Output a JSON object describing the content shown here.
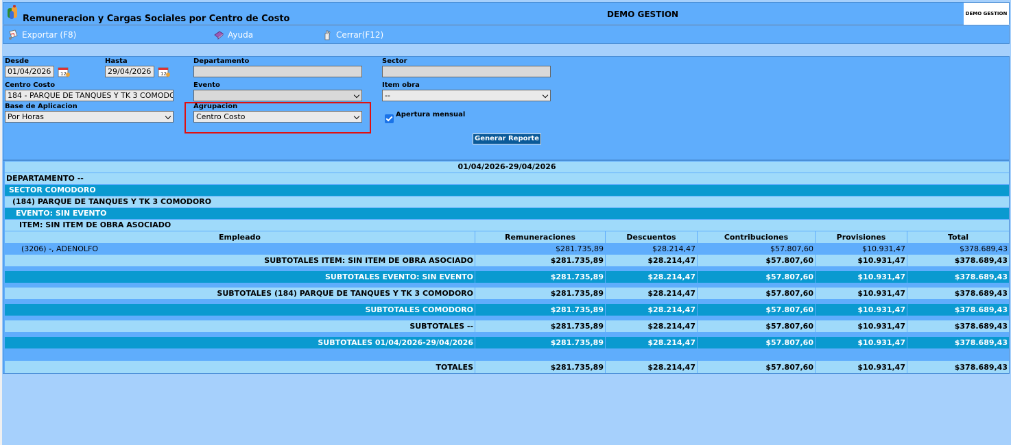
{
  "app": {
    "title": "Remuneracion y Cargas Sociales por Centro de Costo",
    "company": "DEMO GESTION",
    "logo_text": "DEMO GESTION"
  },
  "toolbar": {
    "export_label": "Exportar (F8)",
    "help_label": "Ayuda",
    "close_label": "Cerrar(F12)"
  },
  "filters": {
    "desde_label": "Desde",
    "desde_value": "01/04/2026",
    "hasta_label": "Hasta",
    "hasta_value": "29/04/2026",
    "departamento_label": "Departamento",
    "departamento_value": "",
    "sector_label": "Sector",
    "sector_value": "",
    "centro_costo_label": "Centro Costo",
    "centro_costo_value": "184 - PARQUE DE TANQUES Y TK 3 COMODORO",
    "evento_label": "Evento",
    "evento_value": "",
    "item_obra_label": "Item obra",
    "item_obra_value": "--",
    "base_label": "Base de Aplicacion",
    "base_value": "Por Horas",
    "agrupacion_label": "Agrupacion",
    "agrupacion_value": "Centro Costo",
    "apertura_label": "Apertura mensual",
    "apertura_checked": true,
    "generate_label": "Generar Reporte"
  },
  "report": {
    "period": "01/04/2026-29/04/2026",
    "departamento": "DEPARTAMENTO --",
    "sector": "SECTOR COMODORO",
    "centro": "(184) PARQUE DE TANQUES Y TK 3 COMODORO",
    "evento": "EVENTO: SIN EVENTO",
    "item": "ITEM: SIN ITEM DE OBRA ASOCIADO",
    "columns": [
      "Empleado",
      "Remuneraciones",
      "Descuentos",
      "Contribuciones",
      "Provisiones",
      "Total"
    ],
    "employee": {
      "name": "(3206) -, ADENOLFO",
      "values": [
        "$281.735,89",
        "$28.214,47",
        "$57.807,60",
        "$10.931,47",
        "$378.689,43"
      ]
    },
    "subtotals": [
      {
        "label": "SUBTOTALES ITEM: SIN ITEM DE OBRA ASOCIADO",
        "values": [
          "$281.735,89",
          "$28.214,47",
          "$57.807,60",
          "$10.931,47",
          "$378.689,43"
        ]
      },
      {
        "label": "SUBTOTALES EVENTO: SIN EVENTO",
        "values": [
          "$281.735,89",
          "$28.214,47",
          "$57.807,60",
          "$10.931,47",
          "$378.689,43"
        ]
      },
      {
        "label": "SUBTOTALES (184) PARQUE DE TANQUES Y TK 3 COMODORO",
        "values": [
          "$281.735,89",
          "$28.214,47",
          "$57.807,60",
          "$10.931,47",
          "$378.689,43"
        ]
      },
      {
        "label": "SUBTOTALES COMODORO",
        "values": [
          "$281.735,89",
          "$28.214,47",
          "$57.807,60",
          "$10.931,47",
          "$378.689,43"
        ]
      },
      {
        "label": "SUBTOTALES --",
        "values": [
          "$281.735,89",
          "$28.214,47",
          "$57.807,60",
          "$10.931,47",
          "$378.689,43"
        ]
      },
      {
        "label": "SUBTOTALES 01/04/2026-29/04/2026",
        "values": [
          "$281.735,89",
          "$28.214,47",
          "$57.807,60",
          "$10.931,47",
          "$378.689,43"
        ]
      }
    ],
    "totals": {
      "label": "TOTALES",
      "values": [
        "$281.735,89",
        "$28.214,47",
        "$57.807,60",
        "$10.931,47",
        "$378.689,43"
      ]
    }
  },
  "colors": {
    "panel": "#5fadfc",
    "band_light": "#9fdafa",
    "band_dark": "#0a9ad0",
    "highlight": "#e01010"
  }
}
